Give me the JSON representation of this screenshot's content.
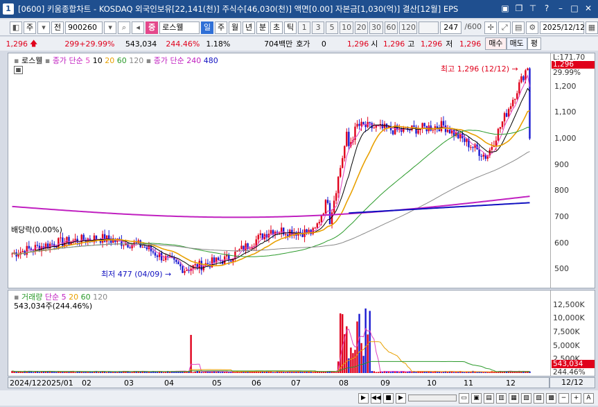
{
  "window": {
    "num": "1",
    "title": "[0600] 키움종합차트 - KOSDAQ 외국인보유[22,141(천)] 주식수[46,030(천)] 액면[0.00] 자본금[1,030(억)] 결산[12월] EPS"
  },
  "toolbar": {
    "period_day": "주",
    "whole": "전",
    "code": "900260",
    "stock_badge": "중",
    "stock_name": "로스웰",
    "tabs": [
      "일",
      "주",
      "월",
      "년",
      "분",
      "초",
      "틱"
    ],
    "intervals": [
      "1",
      "3",
      "5",
      "10",
      "20",
      "30",
      "60",
      "120"
    ],
    "count": "247",
    "total": "/600",
    "date": "2025/12/12"
  },
  "infobar": {
    "price": "1,296",
    "change": "299",
    "change_pct": "+29.99%",
    "volume": "543,034",
    "vol_pct": "244.46%",
    "turnover": "1.18%",
    "amount": "704백만",
    "hoga_label": "호가",
    "hoga": "0",
    "hoga_price": "1,296",
    "open_label": "시",
    "open": "1,296",
    "high_label": "고",
    "high": "1,296",
    "low_label": "저",
    "low": "1,296",
    "buy": "매수",
    "sell": "매도",
    "eval": "평"
  },
  "price_panel": {
    "legend_name": "로스웰",
    "ma_label": "종가 단순",
    "ma_periods": [
      "5",
      "10",
      "20",
      "60",
      "120"
    ],
    "ma_long_label": "종가 단순",
    "ma_long_periods": [
      "240",
      "480"
    ],
    "y_ticks": [
      "1,200",
      "1,100",
      "1,000",
      "900",
      "800",
      "700",
      "600",
      "500"
    ],
    "limit_label": "L:171.70",
    "current_price_tag": "1,296",
    "current_pct_tag": "29.99%",
    "high_note": "최고 1,296 (12/12)",
    "low_note": "최저 477 (04/09)",
    "dividend_note": "배당락(0.00%)"
  },
  "volume_panel": {
    "legend_name": "거래량",
    "ma_label": "단순",
    "ma_periods": [
      "5",
      "20",
      "60",
      "120"
    ],
    "volume_line": "543,034주(244.46%)",
    "y_ticks": [
      "12,500K",
      "10,000K",
      "7,500K",
      "5,000K",
      "2,500K"
    ],
    "current_tag": "543,034",
    "current_pct_tag": "244.46%"
  },
  "x_axis": {
    "labels": [
      "2024/12",
      "2025/01",
      "02",
      "03",
      "04",
      "05",
      "06",
      "07",
      "08",
      "09",
      "10",
      "11",
      "12"
    ],
    "right_label": "12/12"
  },
  "colors": {
    "up": "#e0001b",
    "down": "#1a1ad0",
    "ma5": "#e040c0",
    "ma10": "#000000",
    "ma20": "#e8a000",
    "ma60": "#2a9a2a",
    "ma120": "#888888",
    "ma240": "#c020c0",
    "ma480": "#1010c0"
  },
  "chart_data": {
    "type": "line",
    "title": "",
    "x": [
      "2024/12",
      "2025/01",
      "02",
      "03",
      "04",
      "05",
      "06",
      "07",
      "08",
      "09",
      "10",
      "11",
      "12"
    ],
    "series": [
      {
        "name": "로스웰",
        "values": [
          560,
          600,
          620,
          590,
          500,
          540,
          650,
          640,
          1050,
          1030,
          1050,
          930,
          1296
        ]
      }
    ],
    "ylim": [
      450,
      1300
    ]
  }
}
